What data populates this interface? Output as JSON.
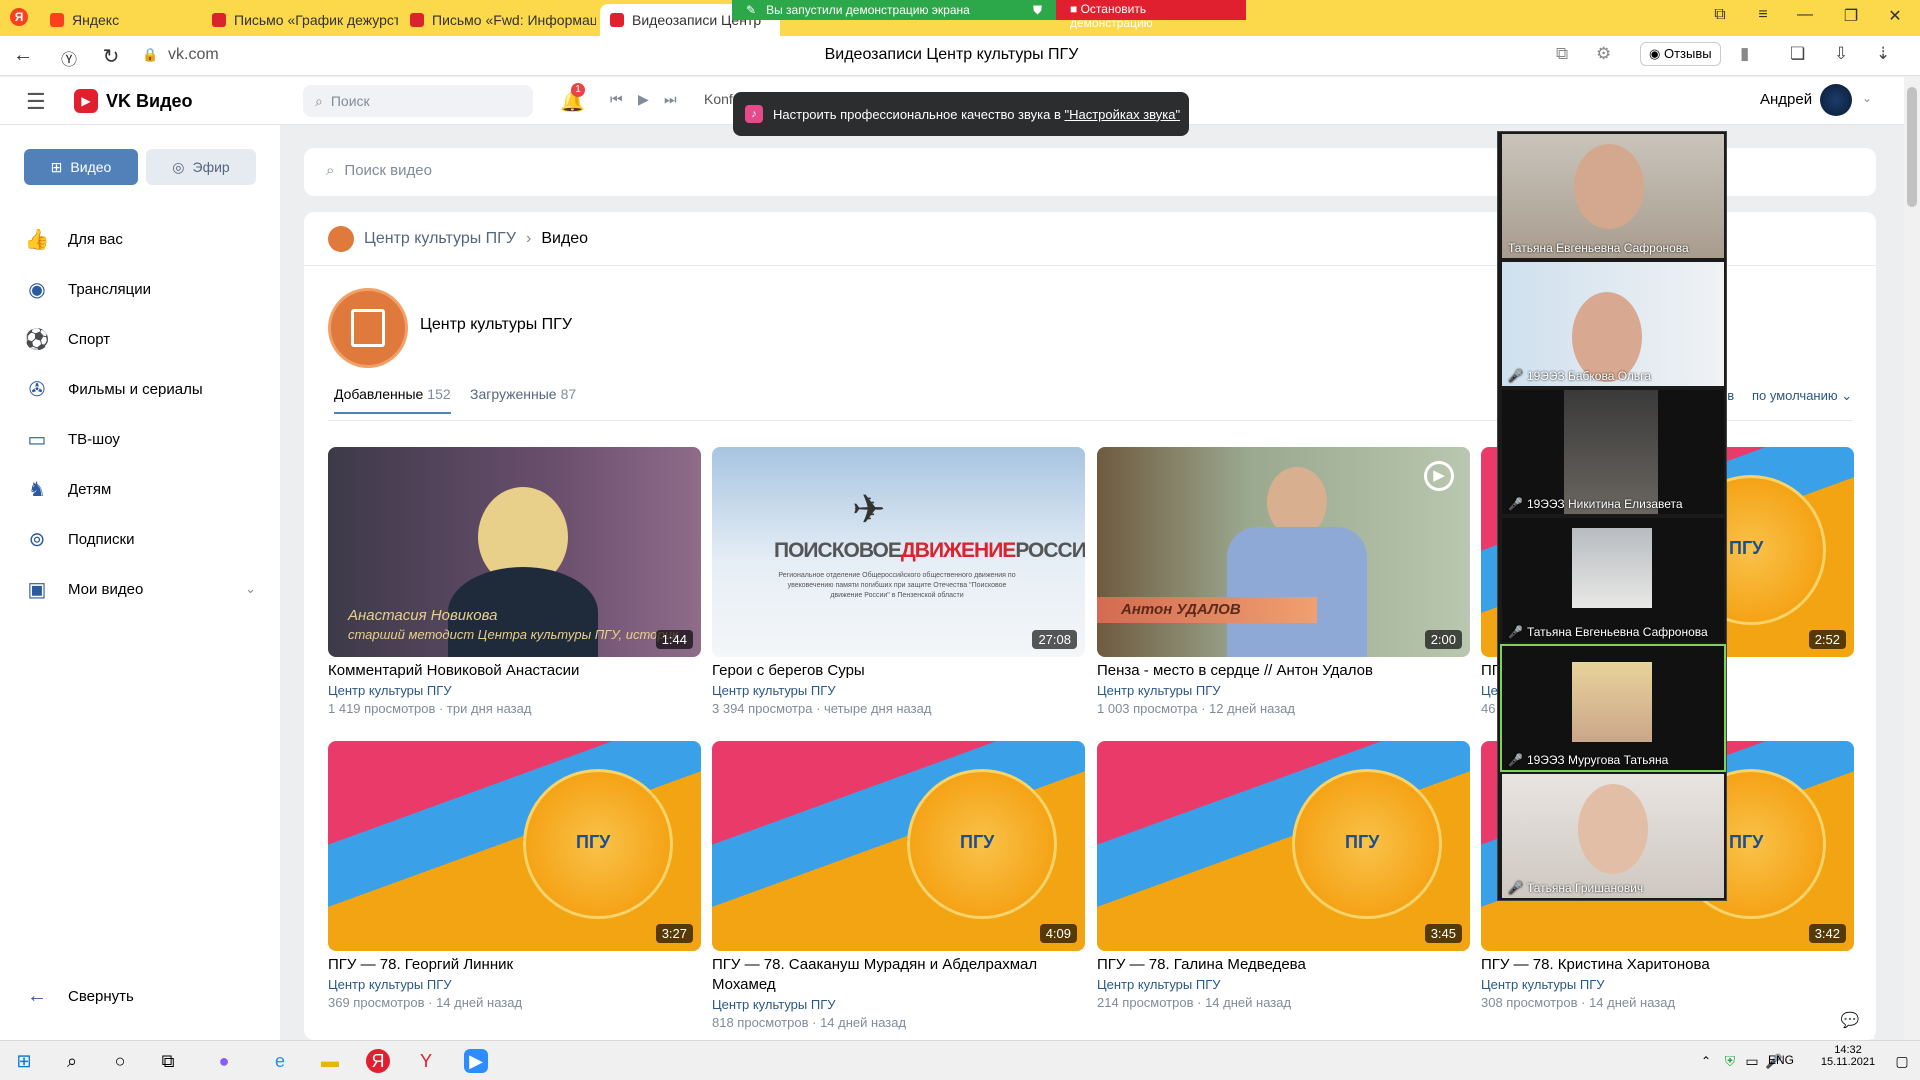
{
  "browser": {
    "tabs": [
      {
        "label": "Яндекс",
        "color": "#fc3f1d"
      },
      {
        "label": "Письмо «График дежурст",
        "color": "#d9232d"
      },
      {
        "label": "Письмо «Fwd: Информац",
        "color": "#d9232d"
      },
      {
        "label": "Видеозаписи Центр",
        "color": "#e0202e"
      }
    ],
    "address": "vk.com",
    "page_title": "Видеозаписи Центр культуры ПГУ",
    "reviews_label": "Отзывы"
  },
  "share": {
    "status": "Вы запустили демонстрацию экрана",
    "stop": "Остановить демонстрацию"
  },
  "toast": {
    "text": "Настроить профессиональное качество звука в ",
    "link": "\"Настройках звука\""
  },
  "header": {
    "logo": "VK Видео",
    "search_placeholder": "Поиск",
    "notif_count": "1",
    "player_track": "Konfuz — Кайф ты поймала",
    "user_name": "Андрей"
  },
  "sidebar": {
    "video_tab": "Видео",
    "live_tab": "Эфир",
    "items": [
      {
        "label": "Для вас",
        "icon": "thumb-up-icon"
      },
      {
        "label": "Трансляции",
        "icon": "broadcast-icon"
      },
      {
        "label": "Спорт",
        "icon": "ball-icon"
      },
      {
        "label": "Фильмы и сериалы",
        "icon": "film-icon"
      },
      {
        "label": "ТВ-шоу",
        "icon": "tv-icon"
      },
      {
        "label": "Детям",
        "icon": "kids-icon"
      },
      {
        "label": "Подписки",
        "icon": "subscriptions-icon"
      },
      {
        "label": "Мои видео",
        "icon": "my-video-icon"
      }
    ],
    "collapse": "Свернуть"
  },
  "main": {
    "search_placeholder": "Поиск видео",
    "breadcrumb": {
      "group": "Центр культуры ПГУ",
      "current": "Видео"
    },
    "group_name": "Центр культуры ПГУ",
    "tabs": [
      {
        "label": "Добавленные",
        "count": "152"
      },
      {
        "label": "Загруженные",
        "count": "87"
      }
    ],
    "sort_partial": "ев",
    "sort": "по умолчанию"
  },
  "videos": [
    {
      "title": "Комментарий Новиковой Анастасии",
      "author": "Центр культуры ПГУ",
      "views": "1 419 просмотров",
      "date": "три дня назад",
      "duration": "1:44",
      "overlay1": "Анастасия Новикова",
      "overlay2": "старший методист Центра культуры ПГУ, историк"
    },
    {
      "title": "Герои с берегов Суры",
      "author": "Центр культуры ПГУ",
      "views": "3 394 просмотра",
      "date": "четыре дня назад",
      "duration": "27:08",
      "logo_a": "ПОИСКОВОЕ",
      "logo_b": "ДВИЖЕНИЕ",
      "logo_c": "РОССИИ",
      "subtext": "Региональное отделение Общероссийского общественного движения по увековечению памяти погибших при защите Отечества \"Поисковое движение России\" в Пензенской области"
    },
    {
      "title": "Пенза - место в сердце // Антон Удалов",
      "author": "Центр культуры ПГУ",
      "views": "1 003 просмотра",
      "date": "12 дней назад",
      "duration": "2:00",
      "overlay1": "Антон УДАЛОВ"
    },
    {
      "title": "ПГ",
      "author": "Це",
      "views": "46",
      "date": "",
      "duration": "2:52"
    },
    {
      "title": "ПГУ — 78. Георгий Линник",
      "author": "Центр культуры ПГУ",
      "views": "369 просмотров",
      "date": "14 дней назад",
      "duration": "3:27"
    },
    {
      "title": "ПГУ — 78. Саакануш Мурадян и Абделрахмал Мохамед",
      "author": "Центр культуры ПГУ",
      "views": "818 просмотров",
      "date": "14 дней назад",
      "duration": "4:09"
    },
    {
      "title": "ПГУ — 78. Галина Медведева",
      "author": "Центр культуры ПГУ",
      "views": "214 просмотров",
      "date": "14 дней назад",
      "duration": "3:45"
    },
    {
      "title": "ПГУ — 78. Кристина Харитонова",
      "author": "Центр культуры ПГУ",
      "views": "308 просмотров",
      "date": "14 дней назад",
      "duration": "3:42"
    }
  ],
  "zoom": {
    "participants": [
      {
        "name": "Татьяна Евгеньевна Сафронова",
        "muted": false
      },
      {
        "name": "19ЭЭЗ Бабкова Ольга",
        "muted": true
      },
      {
        "name": "19ЭЭЗ Никитина Елизавета",
        "muted": true
      },
      {
        "name": "Татьяна Евгеньевна Сафронова",
        "muted": true
      },
      {
        "name": "19ЭЭЗ Муругова Татьяна",
        "muted": true
      },
      {
        "name": "Татьяна Гришанович",
        "muted": true
      }
    ]
  },
  "taskbar": {
    "lang": "ENG",
    "time": "14:32",
    "date": "15.11.2021"
  },
  "colors": {
    "accent": "#2c5aa0",
    "yandex_yellow": "#fbd94a",
    "zoom_green": "#2ca84a",
    "stop_red": "#e0202e"
  }
}
